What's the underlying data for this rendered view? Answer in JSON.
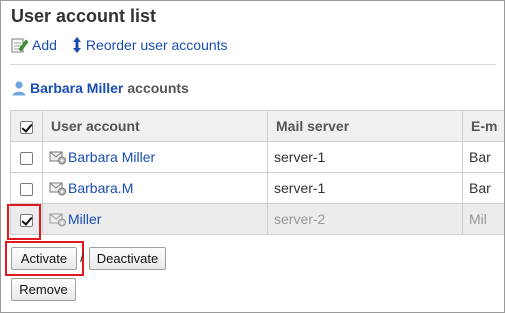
{
  "page": {
    "title": "User account list"
  },
  "actions": {
    "add_label": "Add",
    "reorder_label": "Reorder user accounts"
  },
  "owner": {
    "name": "Barbara Miller",
    "suffix": "accounts"
  },
  "table": {
    "headers": {
      "user_account": "User account",
      "mail_server": "Mail server",
      "email": "E-m"
    },
    "rows": [
      {
        "user_account": "Barbara Miller",
        "mail_server": "server-1",
        "email": "Bar",
        "checked": false,
        "disabled": false
      },
      {
        "user_account": "Barbara.M",
        "mail_server": "server-1",
        "email": "Bar",
        "checked": false,
        "disabled": false
      },
      {
        "user_account": "Miller",
        "mail_server": "server-2",
        "email": "Mil",
        "checked": true,
        "disabled": true
      }
    ]
  },
  "buttons": {
    "activate": "Activate",
    "separator": "/",
    "deactivate": "Deactivate",
    "remove": "Remove"
  },
  "colors": {
    "link": "#1a4db3",
    "highlight": "#e0191e",
    "header_bg": "#f0f0f0",
    "disabled_row_bg": "#ececec"
  }
}
